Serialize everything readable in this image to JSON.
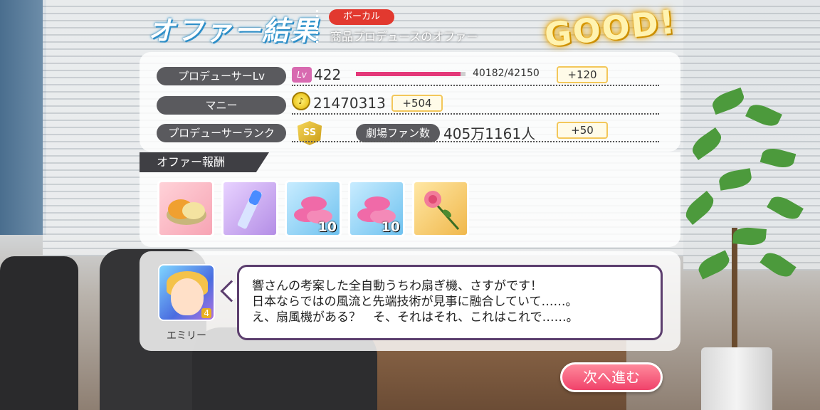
{
  "header": {
    "title": "オファー結果",
    "category_badge": "ボーカル",
    "offer_name": "商品プロデュースのオファー",
    "rating": "GOOD!"
  },
  "stats": {
    "producer_lv": {
      "label": "プロデューサーLv",
      "icon": "Lv",
      "value": "422",
      "exp_text": "40182/42150",
      "exp_fraction": 0.953,
      "gain": "+120"
    },
    "money": {
      "label": "マニー",
      "value": "21470313",
      "gain": "+504"
    },
    "producer_rank": {
      "label": "プロデューサーランク",
      "rank": "SS"
    },
    "theater_fans": {
      "label": "劇場ファン数",
      "value": "405万1161人",
      "gain": "+50"
    }
  },
  "rewards": {
    "header": "オファー報酬",
    "items": [
      {
        "icon": "cosmetic-compact-icon",
        "qty": ""
      },
      {
        "icon": "lipstick-icon",
        "qty": ""
      },
      {
        "icon": "candy-icon",
        "qty": "10"
      },
      {
        "icon": "candy-icon",
        "qty": "10"
      },
      {
        "icon": "rose-icon",
        "qty": ""
      }
    ]
  },
  "message": {
    "character_name": "エミリー",
    "card_stars": "4",
    "lines": [
      "響さんの考案した全自動うちわ扇ぎ機、さすがです！",
      "日本ならではの風流と先端技術が見事に融合していて……。",
      "え、扇風機がある？　そ、それはそれ、これはこれで……。"
    ]
  },
  "actions": {
    "next_label": "次へ進む"
  },
  "colors": {
    "accent_pink": "#e43879",
    "category_red": "#e2392f",
    "gain_border": "#f3c75a",
    "speech_border": "#5c3e6e"
  }
}
